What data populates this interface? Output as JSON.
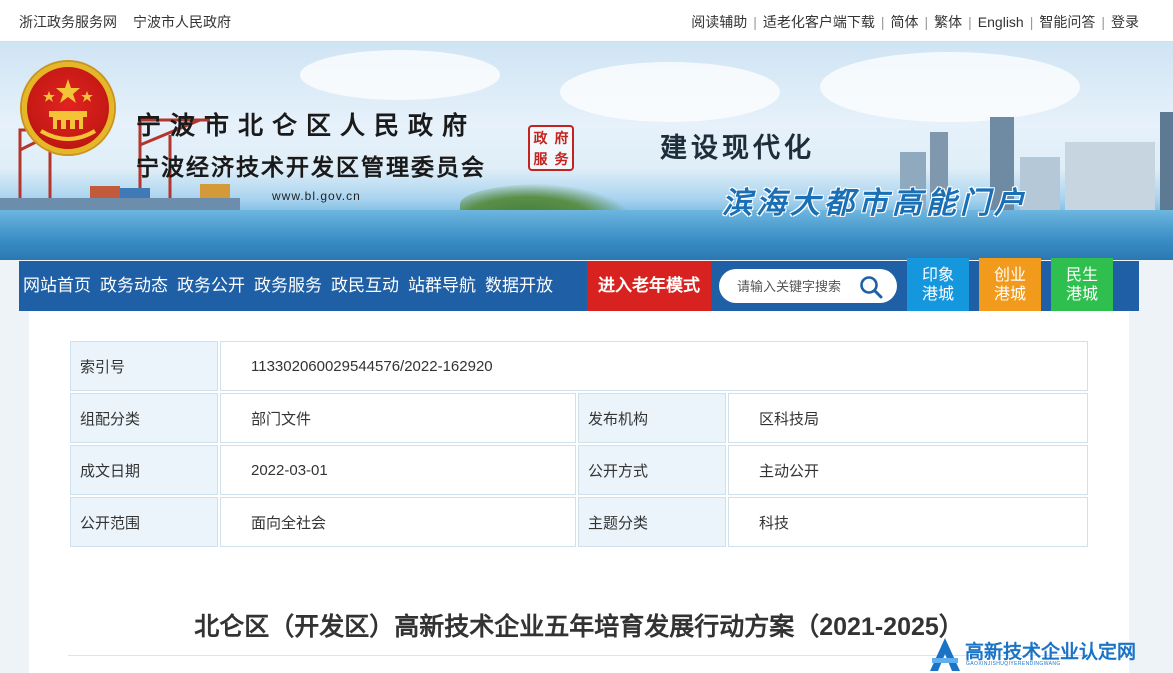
{
  "topbar": {
    "left_links": [
      "浙江政务服务网",
      "宁波市人民政府"
    ],
    "right_links": [
      "阅读辅助",
      "适老化客户端下载",
      "简体",
      "繁体",
      "English",
      "智能问答",
      "登录"
    ]
  },
  "banner": {
    "title": "宁波市北仑区人民政府",
    "subtitle": "宁波经济技术开发区管理委员会",
    "url": "www.bl.gov.cn",
    "seal_chars": [
      "政",
      "府",
      "服",
      "务"
    ],
    "slogan_line1": "建设现代化",
    "slogan_line2": "滨海大都市高能门户"
  },
  "nav": {
    "items": [
      "网站首页",
      "政务动态",
      "政务公开",
      "政务服务",
      "政民互动",
      "站群导航",
      "数据开放"
    ],
    "elder_mode": "进入老年模式",
    "search_placeholder": "请输入关键字搜索"
  },
  "side_buttons": [
    {
      "line1": "印象",
      "line2": "港城",
      "color": "#1597de"
    },
    {
      "line1": "创业",
      "line2": "港城",
      "color": "#f29a1c"
    },
    {
      "line1": "民生",
      "line2": "港城",
      "color": "#2fbf4f"
    }
  ],
  "info": {
    "index_label": "索引号",
    "index_value": "113302060029544576/2022-162920",
    "rows": [
      {
        "label1": "组配分类",
        "value1": "部门文件",
        "label2": "发布机构",
        "value2": "区科技局"
      },
      {
        "label1": "成文日期",
        "value1": "2022-03-01",
        "label2": "公开方式",
        "value2": "主动公开"
      },
      {
        "label1": "公开范围",
        "value1": "面向全社会",
        "label2": "主题分类",
        "value2": "科技"
      }
    ]
  },
  "document": {
    "title": "北仑区（开发区）高新技术企业五年培育发展行动方案（2021-2025）"
  },
  "watermark": {
    "text": "高新技术企业认定网",
    "sub": "GAOXINJISHUQIYERENDINGWANG"
  },
  "colors": {
    "nav_blue": "#1f5fa5",
    "elder_red": "#d8221f",
    "label_bg": "#eaf4fa"
  }
}
